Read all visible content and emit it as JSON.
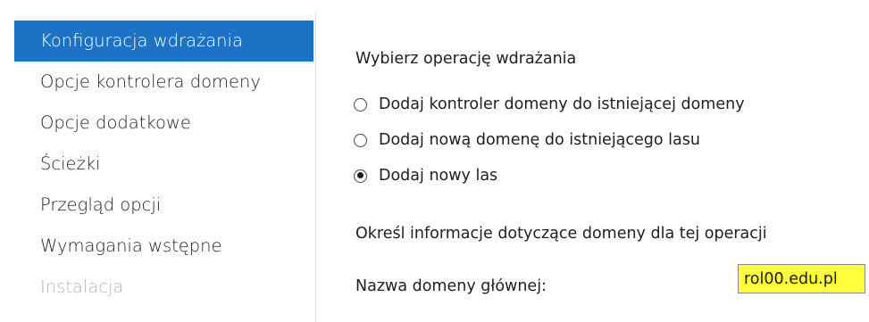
{
  "nav": {
    "items": [
      {
        "label": "Konfiguracja wdrażania",
        "state": "active"
      },
      {
        "label": "Opcje kontrolera domeny",
        "state": "normal"
      },
      {
        "label": "Opcje dodatkowe",
        "state": "normal"
      },
      {
        "label": "Ścieżki",
        "state": "normal"
      },
      {
        "label": "Przegląd opcji",
        "state": "normal"
      },
      {
        "label": "Wymagania wstępne",
        "state": "normal"
      },
      {
        "label": "Instalacja",
        "state": "disabled"
      }
    ]
  },
  "main": {
    "operation_heading": "Wybierz operację wdrażania",
    "operations": [
      {
        "label": "Dodaj kontroler domeny do istniejącej domeny",
        "selected": false
      },
      {
        "label": "Dodaj nową domenę do istniejącego lasu",
        "selected": false
      },
      {
        "label": "Dodaj nowy las",
        "selected": true
      }
    ],
    "domain_heading": "Określ informacje dotyczące domeny dla tej operacji",
    "root_domain": {
      "label": "Nazwa domeny głównej:",
      "value": "rol00.edu.pl"
    }
  },
  "colors": {
    "nav_active_bg": "#1c73c6",
    "input_highlight": "#ffff3c",
    "disabled_text": "#b4b4b4"
  }
}
